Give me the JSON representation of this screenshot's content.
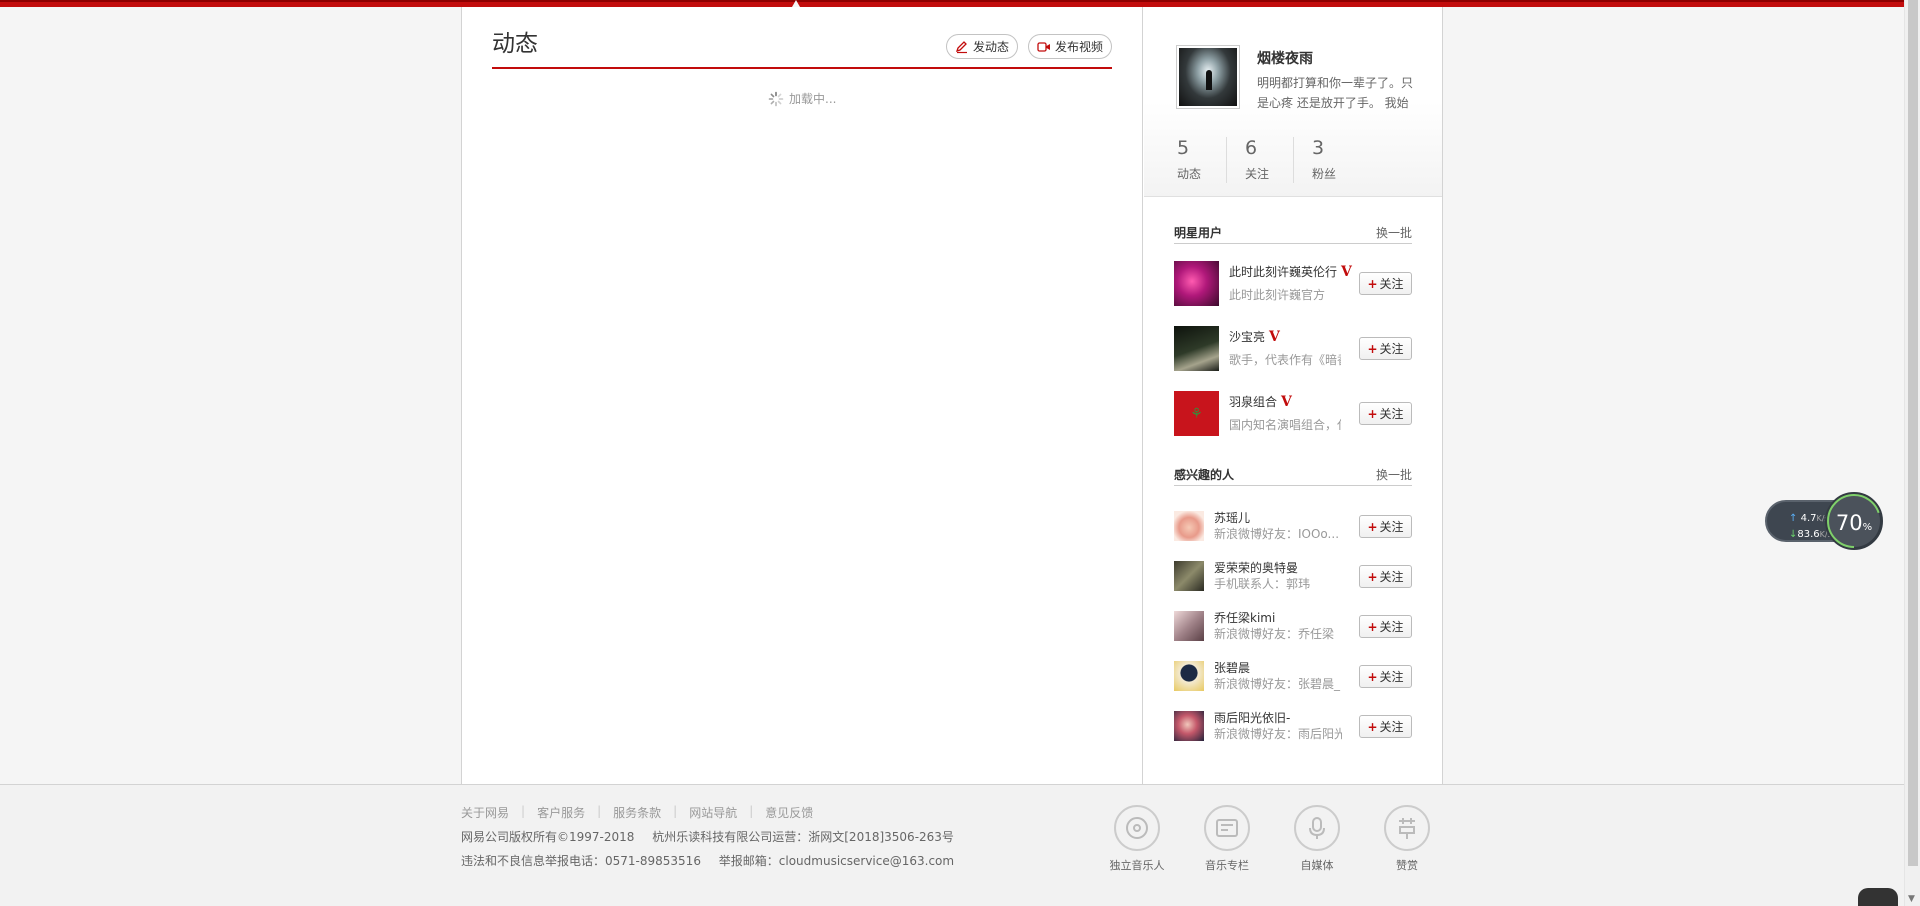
{
  "main": {
    "title": "动态",
    "post_label": "发动态",
    "video_label": "发布视频",
    "loading_text": "加载中..."
  },
  "profile": {
    "name": "烟楼夜雨",
    "bio": "明明都打算和你一辈子了。只是心疼 还是放开了手。 我始",
    "stats": [
      {
        "num": "5",
        "label": "动态"
      },
      {
        "num": "6",
        "label": "关注"
      },
      {
        "num": "3",
        "label": "粉丝"
      }
    ]
  },
  "stars": {
    "title": "明星用户",
    "more": "换一批",
    "items": [
      {
        "name": "此时此刻许巍英伦行",
        "desc": "此时此刻许巍官方",
        "badge": "V"
      },
      {
        "name": "沙宝亮",
        "desc": "歌手，代表作有《暗香》",
        "badge": "V"
      },
      {
        "name": "羽泉组合",
        "desc": "国内知名演唱组合，代表作",
        "badge": "V"
      }
    ]
  },
  "interest": {
    "title": "感兴趣的人",
    "more": "换一批",
    "items": [
      {
        "name": "苏瑶儿",
        "desc": "新浪微博好友：IOOo..."
      },
      {
        "name": "爱荣荣的奥特曼",
        "desc": "手机联系人：郭玮"
      },
      {
        "name": "乔任梁kimi",
        "desc": "新浪微博好友：乔任梁"
      },
      {
        "name": "张碧晨",
        "desc": "新浪微博好友：张碧晨_"
      },
      {
        "name": "雨后阳光依旧-",
        "desc": "新浪微博好友：雨后阳光依旧"
      }
    ]
  },
  "follow_label": "关注",
  "follow_plus": "+",
  "footer": {
    "links": [
      "关于网易",
      "客户服务",
      "服务条款",
      "网站导航",
      "意见反馈"
    ],
    "separator": "|",
    "copyright": "网易公司版权所有©1997-2018",
    "operator": "杭州乐读科技有限公司运营：浙网文[2018]3506-263号",
    "report_phone": "违法和不良信息举报电话：0571-89853516",
    "report_email": "举报邮箱：cloudmusicservice@163.com",
    "icons": [
      {
        "label": "独立音乐人",
        "icon": "vinyl-icon"
      },
      {
        "label": "音乐专栏",
        "icon": "column-icon"
      },
      {
        "label": "自媒体",
        "icon": "mic-icon"
      },
      {
        "label": "赞赏",
        "icon": "reward-icon"
      }
    ]
  },
  "netwidget": {
    "up_speed": "4.7",
    "down_speed": "83.6",
    "unit": "K/s",
    "percent": "70",
    "percent_sign": "%"
  },
  "colors": {
    "accent": "#c20c0c"
  }
}
